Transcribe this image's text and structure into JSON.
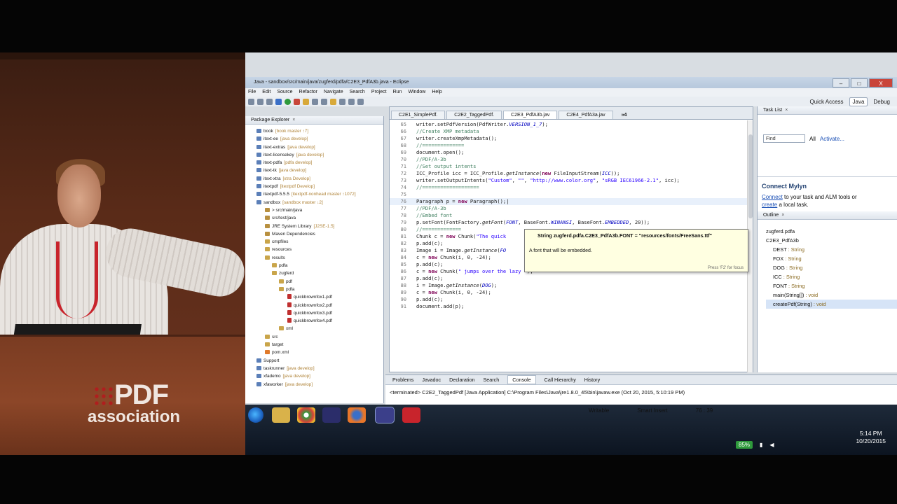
{
  "window": {
    "title": "Java - sandbox/src/main/java/zugferd/pdfa/C2E3_PdfA3b.java - Eclipse",
    "controls": [
      "–",
      "□",
      "X"
    ]
  },
  "menu": [
    "File",
    "Edit",
    "Source",
    "Refactor",
    "Navigate",
    "Search",
    "Project",
    "Run",
    "Window",
    "Help"
  ],
  "toolbar_right": {
    "quick_access": "Quick Access",
    "perspective_java": "Java",
    "perspective_debug": "Debug"
  },
  "package_explorer": {
    "tab_label": "Package Explorer",
    "rows": [
      {
        "name": "book",
        "deco": "[book master ↑7]",
        "type": "prj",
        "indent": "ind0"
      },
      {
        "name": "itext-ee",
        "deco": "[java develop]",
        "type": "prj",
        "indent": "ind0"
      },
      {
        "name": "itext-extras",
        "deco": "[java develop]",
        "type": "prj",
        "indent": "ind0"
      },
      {
        "name": "itext-licensekey",
        "deco": "[java develop]",
        "type": "prj",
        "indent": "ind0"
      },
      {
        "name": "itext-pdfa",
        "deco": "[pdfa develop]",
        "type": "prj",
        "indent": "ind0"
      },
      {
        "name": "itext-tk",
        "deco": "[java develop]",
        "type": "prj",
        "indent": "ind0"
      },
      {
        "name": "itext-xtra",
        "deco": "[xtra Develop]",
        "type": "prj",
        "indent": "ind0"
      },
      {
        "name": "itextpdf",
        "deco": "[itextpdf Develop]",
        "type": "prj",
        "indent": "ind0"
      },
      {
        "name": "itextpdf-5.5.5",
        "deco": "[itextpdf-nonhead master ↑1072]",
        "type": "prj",
        "indent": "ind0"
      },
      {
        "name": "sandbox",
        "deco": "[sandbox master ↓2]",
        "type": "prj",
        "indent": "ind0"
      },
      {
        "name": "> src/main/java",
        "deco": "",
        "type": "src",
        "indent": "ind1"
      },
      {
        "name": "src/test/java",
        "deco": "",
        "type": "src",
        "indent": "ind1"
      },
      {
        "name": "JRE System Library",
        "deco": "[J2SE-1.5]",
        "type": "src",
        "indent": "ind1"
      },
      {
        "name": "Maven Dependencies",
        "deco": "",
        "type": "src",
        "indent": "ind1"
      },
      {
        "name": "cmpfiles",
        "deco": "",
        "type": "folder",
        "indent": "ind1"
      },
      {
        "name": "resources",
        "deco": "",
        "type": "folder",
        "indent": "ind1"
      },
      {
        "name": "results",
        "deco": "",
        "type": "folder",
        "indent": "ind1"
      },
      {
        "name": "pdfa",
        "deco": "",
        "type": "folder",
        "indent": "ind2"
      },
      {
        "name": "zugferd",
        "deco": "",
        "type": "folder",
        "indent": "ind2"
      },
      {
        "name": "pdf",
        "deco": "",
        "type": "folder",
        "indent": "ind3"
      },
      {
        "name": "pdfa",
        "deco": "",
        "type": "folder",
        "indent": "ind3"
      },
      {
        "name": "quickbrownfox1.pdf",
        "deco": "",
        "type": "file",
        "indent": "ind4"
      },
      {
        "name": "quickbrownfox2.pdf",
        "deco": "",
        "type": "file",
        "indent": "ind4"
      },
      {
        "name": "quickbrownfox3.pdf",
        "deco": "",
        "type": "file",
        "indent": "ind4"
      },
      {
        "name": "quickbrownfox4.pdf",
        "deco": "",
        "type": "file",
        "indent": "ind4"
      },
      {
        "name": "xml",
        "deco": "",
        "type": "folder",
        "indent": "ind3"
      },
      {
        "name": "src",
        "deco": "",
        "type": "folder",
        "indent": "ind1"
      },
      {
        "name": "target",
        "deco": "",
        "type": "folder",
        "indent": "ind1"
      },
      {
        "name": "pom.xml",
        "deco": "",
        "type": "xml",
        "indent": "ind1"
      },
      {
        "name": "Support",
        "deco": "",
        "type": "prj",
        "indent": "ind0"
      },
      {
        "name": "taskrunner",
        "deco": "[java develop]",
        "type": "prj",
        "indent": "ind0"
      },
      {
        "name": "xfademo",
        "deco": "[java develop]",
        "type": "prj",
        "indent": "ind0"
      },
      {
        "name": "xfaworker",
        "deco": "[java develop]",
        "type": "prj",
        "indent": "ind0"
      }
    ]
  },
  "editor": {
    "tabs": [
      "C2E1_SimplePdf.",
      "C2E2_TaggedPdf.",
      "C2E3_PdfA3b.jav",
      "C2E4_PdfA3a.jav",
      "»4"
    ],
    "active_tab": 2,
    "lines": [
      {
        "n": "65",
        "html": "writer.setPdfVersion(PdfWriter.<span class='fld'>VERSION_1_7</span>);"
      },
      {
        "n": "66",
        "html": "<span class='cm'>//Create XMP metadata</span>"
      },
      {
        "n": "67",
        "html": "writer.createXmpMetadata();"
      },
      {
        "n": "68",
        "html": "<span class='cm'>//==============</span>"
      },
      {
        "n": "69",
        "html": "document.open();"
      },
      {
        "n": "70",
        "html": "<span class='cm'>//PDF/A-3b</span>"
      },
      {
        "n": "71",
        "html": "<span class='cm'>//Set output intents</span>"
      },
      {
        "n": "72",
        "html": "ICC_Profile icc = ICC_Profile.<i>getInstance</i>(<span class='kw'>new</span> FileInputStream(<span class='fld'>ICC</span>));"
      },
      {
        "n": "73",
        "html": "writer.setOutputIntents(<span class='str'>\"Custom\"</span>, <span class='str'>\"\"</span>, <span class='str'>\"http://www.color.org\"</span>, <span class='str'>\"sRGB IEC61966-2.1\"</span>, icc);"
      },
      {
        "n": "74",
        "html": "<span class='cm'>//===================</span>"
      },
      {
        "n": "75",
        "html": ""
      },
      {
        "n": "76",
        "html": "Paragraph p = <span class='kw'>new</span> Paragraph();|"
      },
      {
        "n": "77",
        "html": "<span class='cm'>//PDF/A-3b</span>"
      },
      {
        "n": "78",
        "html": "<span class='cm'>//Embed font</span>"
      },
      {
        "n": "79",
        "html": "p.setFont(FontFactory.<i>getFont</i>(<span class='fld'>FONT</span>, BaseFont.<span class='fld'>WINANSI</span>, BaseFont.<span class='fld'>EMBEDDED</span>, 20));"
      },
      {
        "n": "80",
        "html": "<span class='cm'>//=============</span>"
      },
      {
        "n": "81",
        "html": "Chunk c = <span class='kw'>new</span> Chunk(<span class='str'>\"The quick</span>"
      },
      {
        "n": "82",
        "html": "p.add(c);"
      },
      {
        "n": "83",
        "html": "Image i = Image.<i>getInstance</i>(<span class='fld'>FO</span>"
      },
      {
        "n": "84",
        "html": "c = <span class='kw'>new</span> Chunk(i, 0, -24);"
      },
      {
        "n": "85",
        "html": "p.add(c);"
      },
      {
        "n": "86",
        "html": "c = <span class='kw'>new</span> Chunk(<span class='str'>\" jumps over the lazy \"</span>);"
      },
      {
        "n": "87",
        "html": "p.add(c);"
      },
      {
        "n": "88",
        "html": "i = Image.<i>getInstance</i>(<span class='fld'>DOG</span>);"
      },
      {
        "n": "89",
        "html": "c = <span class='kw'>new</span> Chunk(i, 0, -24);"
      },
      {
        "n": "90",
        "html": "p.add(c);"
      },
      {
        "n": "91",
        "html": "document.add(p);"
      }
    ],
    "current_line": "76"
  },
  "hover": {
    "signature": "String zugferd.pdfa.C2E3_PdfA3b.FONT = \"resources/fonts/FreeSans.ttf\"",
    "doc": "A font that will be embedded.",
    "footer": "Press 'F2' for focus"
  },
  "task_list": {
    "tab_label": "Task List",
    "find": "Find",
    "all": "All",
    "activate": "Activate..."
  },
  "mylyn": {
    "title": "Connect Mylyn",
    "connect": "Connect",
    "text1": "to your task and ALM tools or",
    "create": "create",
    "text2": "a local task."
  },
  "outline": {
    "tab_label": "Outline",
    "items": [
      {
        "label": "zugferd.pdfa",
        "type": "",
        "cls": ""
      },
      {
        "label": "C2E3_PdfA3b",
        "type": "",
        "cls": ""
      },
      {
        "label": "DEST",
        "type": " : String",
        "cls": "o1"
      },
      {
        "label": "FOX",
        "type": " : String",
        "cls": "o1"
      },
      {
        "label": "DOG",
        "type": " : String",
        "cls": "o1"
      },
      {
        "label": "ICC",
        "type": " : String",
        "cls": "o1"
      },
      {
        "label": "FONT",
        "type": " : String",
        "cls": "o1"
      },
      {
        "label": "main(String[])",
        "type": " : void",
        "cls": "o1"
      },
      {
        "label": "createPdf(String)",
        "type": " : void",
        "cls": "o1 sel"
      }
    ]
  },
  "console": {
    "tabs": [
      "Problems",
      "Javadoc",
      "Declaration",
      "Search",
      "Console",
      "Call Hierarchy",
      "History"
    ],
    "active_tab": 4,
    "status": "<terminated> C2E2_TaggedPdf [Java Application] C:\\Program Files\\Java\\jre1.8.0_45\\bin\\javaw.exe (Oct 20, 2015, 5:10:19 PM)"
  },
  "status_bar": {
    "writable": "Writable",
    "insert": "Smart Insert",
    "position": "76 : 39"
  },
  "taskbar": {
    "battery": "85%",
    "time": "5:14 PM",
    "date": "10/20/2015"
  },
  "podium": {
    "logo_pdf": "PDF",
    "logo_association": "association"
  }
}
